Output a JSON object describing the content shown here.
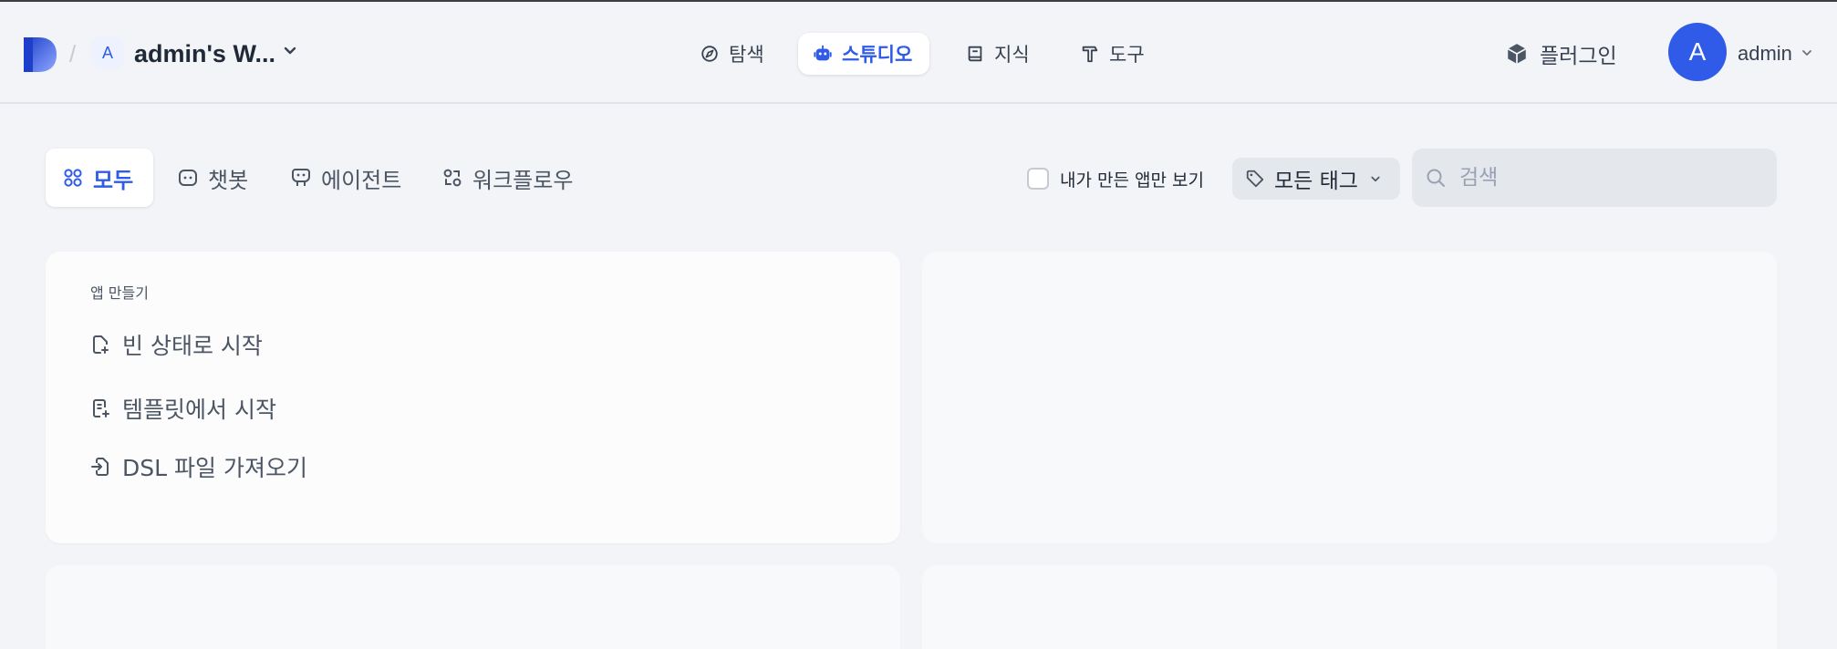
{
  "workspace": {
    "logo_icon": "dify-logo-icon",
    "separator": "/",
    "avatar_letter": "A",
    "name": "admin's W..."
  },
  "nav": {
    "items": [
      {
        "label": "탐색",
        "icon": "compass-icon",
        "active": false
      },
      {
        "label": "스튜디오",
        "icon": "robot-icon",
        "active": true
      },
      {
        "label": "지식",
        "icon": "book-icon",
        "active": false
      },
      {
        "label": "도구",
        "icon": "hammer-icon",
        "active": false
      }
    ]
  },
  "plugin": {
    "label": "플러그인",
    "icon": "cube-icon"
  },
  "user": {
    "avatar_letter": "A",
    "name": "admin"
  },
  "filters": {
    "tabs": [
      {
        "label": "모두",
        "icon": "grid-icon",
        "active": true
      },
      {
        "label": "챗봇",
        "icon": "chat-icon",
        "active": false
      },
      {
        "label": "에이전트",
        "icon": "agent-icon",
        "active": false
      },
      {
        "label": "워크플로우",
        "icon": "workflow-icon",
        "active": false
      }
    ],
    "mine_only_label": "내가 만든 앱만 보기",
    "mine_only_checked": false,
    "tag_select": {
      "label": "모든 태그",
      "icon": "tag-icon"
    },
    "search": {
      "placeholder": "검색",
      "value": ""
    }
  },
  "create_card": {
    "title": "앱 만들기",
    "items": [
      {
        "label": "빈 상태로 시작",
        "icon": "new-file-icon"
      },
      {
        "label": "템플릿에서 시작",
        "icon": "template-icon"
      },
      {
        "label": "DSL 파일 가져오기",
        "icon": "import-file-icon"
      }
    ]
  },
  "colors": {
    "accent": "#2f5be8",
    "background": "#f2f4f7",
    "card": "#fcfcfd",
    "text_muted": "#4b5563"
  }
}
